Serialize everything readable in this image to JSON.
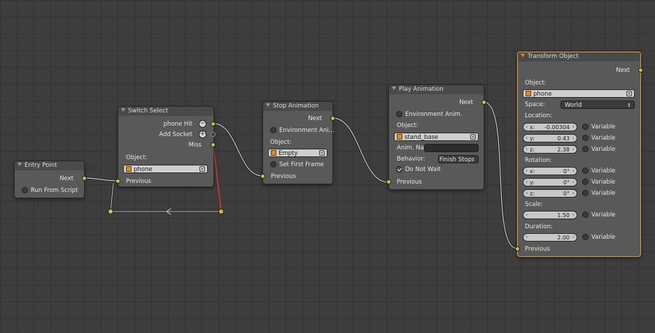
{
  "nodes": {
    "entry_point": {
      "title": "Entry Point",
      "next_label": "Next",
      "run_from_script_label": "Run From Script"
    },
    "switch_select": {
      "title": "Switch Select",
      "phone_hit_label": "phone Hit",
      "phone_hit_button": "−",
      "add_socket_label": "Add Socket",
      "add_socket_button": "+",
      "miss_label": "Miss",
      "object_label": "Object:",
      "object_value": "phone",
      "previous_label": "Previous"
    },
    "stop_animation": {
      "title": "Stop Animation",
      "next_label": "Next",
      "environment_label": "Environment Ani...",
      "object_label": "Object:",
      "object_value": "Empty",
      "set_first_frame_label": "Set First Frame",
      "previous_label": "Previous"
    },
    "play_animation": {
      "title": "Play Animation",
      "next_label": "Next",
      "environment_label": "Environment Anim.",
      "object_label": "Object:",
      "object_value": "stand_base",
      "anim_name_label": "Anim. Na",
      "anim_name_value": "",
      "behavior_label": "Behavior:",
      "behavior_value": "Finish Stop",
      "do_not_wait_label": "Do Not Wait",
      "previous_label": "Previous"
    },
    "transform_object": {
      "title": "Transform Object",
      "next_label": "Next",
      "object_label": "Object:",
      "object_value": "phone",
      "space_label": "Space:",
      "space_value": "World",
      "location_label": "Location:",
      "location": [
        {
          "axis": "x:",
          "value": "-0.00304"
        },
        {
          "axis": "y:",
          "value": "0.43"
        },
        {
          "axis": "z:",
          "value": "2.38"
        }
      ],
      "rotation_label": "Rotation:",
      "rotation": [
        {
          "axis": "x:",
          "value": "0°"
        },
        {
          "axis": "y:",
          "value": "0°"
        },
        {
          "axis": "z:",
          "value": "0°"
        }
      ],
      "scale_label": "Scale:",
      "scale_value": "1.50",
      "duration_label": "Duration:",
      "duration_value": "2.00",
      "variable_label": "Variable",
      "previous_label": "Previous"
    }
  },
  "colors": {
    "socket": "#c8c832",
    "wire": "#1e1e1e",
    "active_wire": "#d63a3a",
    "active_border": "#e59a32"
  }
}
